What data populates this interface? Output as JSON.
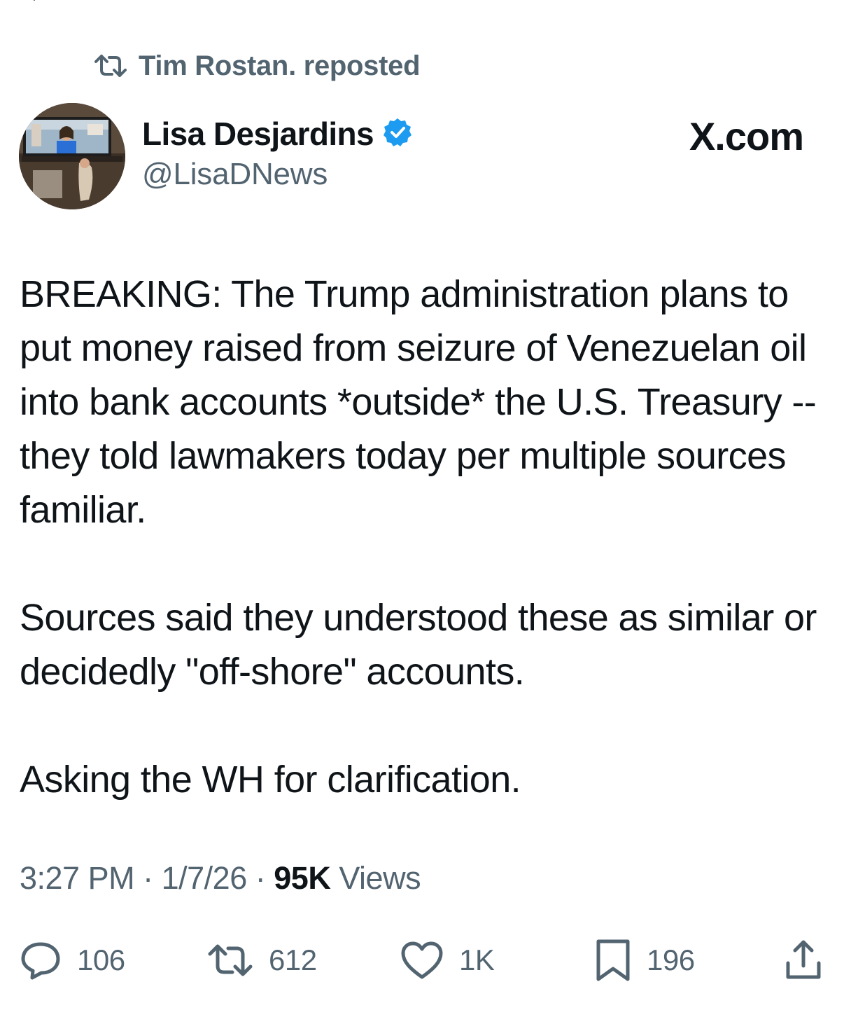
{
  "repost_banner": {
    "icon": "repost-icon",
    "text": "Tim Rostan. reposted"
  },
  "author": {
    "avatar": "avatar",
    "display_name": "Lisa Desjardins",
    "verified_icon": "verified-badge-icon",
    "handle": "@LisaDNews"
  },
  "watermark": "X.com",
  "tweet": {
    "paragraphs": [
      "BREAKING: The Trump administration plans to put money raised from seizure of Venezuelan oil into bank accounts *outside* the U.S. Treasury -- they told lawmakers today per multiple sources familiar.",
      "Sources said they understood these as similar or decidedly \"off-shore\" accounts.",
      "Asking the WH for clarification."
    ]
  },
  "meta": {
    "time": "3:27 PM",
    "separator": "·",
    "date": "1/7/26",
    "views_count": "95K",
    "views_label": "Views"
  },
  "actions": {
    "replies": {
      "icon": "reply-icon",
      "count": "106"
    },
    "reposts": {
      "icon": "repost-icon",
      "count": "612"
    },
    "likes": {
      "icon": "like-icon",
      "count": "1K"
    },
    "bookmarks": {
      "icon": "bookmark-icon",
      "count": "196"
    },
    "share": {
      "icon": "share-icon"
    }
  },
  "colors": {
    "text_primary": "#0f1419",
    "text_secondary": "#536471",
    "verified_blue": "#1d9bf0"
  }
}
